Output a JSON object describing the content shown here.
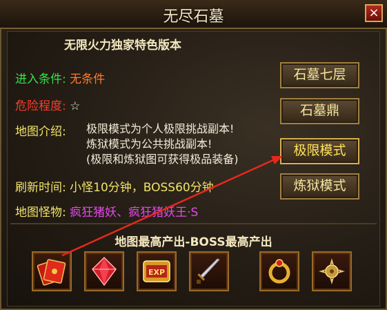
{
  "window": {
    "title": "无尽石墓",
    "close_label": "×"
  },
  "subtitle": "无限火力独家特色版本",
  "info": {
    "entry": {
      "label": "进入条件:",
      "value": "无条件"
    },
    "danger": {
      "label": "危险程度:",
      "value": "☆"
    },
    "intro": {
      "label": "地图介绍:",
      "lines": [
        "极限模式为个人极限挑战副本!",
        "炼狱模式为公共挑战副本!",
        "(极限和炼狱图可获得极品装备)"
      ]
    },
    "refresh": {
      "label": "刷新时间:",
      "value": "小怪10分钟，BOSS60分钟"
    },
    "monsters": {
      "label": "地图怪物:",
      "value": "疯狂猪妖、疯狂猪妖王·S"
    }
  },
  "buttons": [
    "石墓七层",
    "石墓鼎",
    "极限模式",
    "炼狱模式"
  ],
  "rewards": {
    "title": "地图最高产出-BOSS最高产出",
    "items": [
      {
        "icon": "red-envelope-icon"
      },
      {
        "icon": "red-gem-icon"
      },
      {
        "icon": "exp-scroll-icon",
        "text": "EXP"
      },
      {
        "icon": "sword-icon"
      },
      {
        "icon": "gold-ring-icon"
      },
      {
        "icon": "gold-ornament-icon"
      }
    ]
  }
}
